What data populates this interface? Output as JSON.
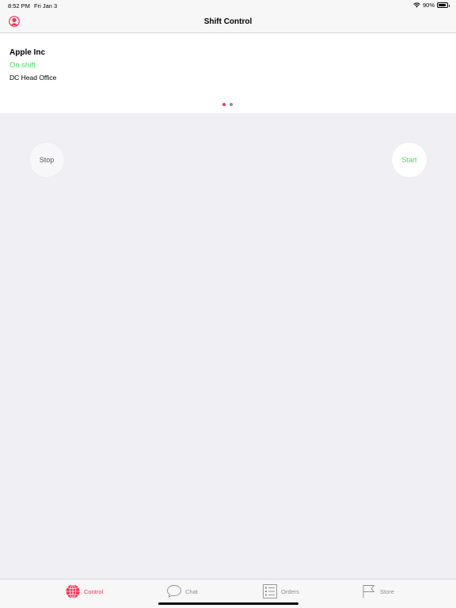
{
  "status_bar": {
    "time": "8:52 PM",
    "date": "Fri Jan 3",
    "battery": "90%",
    "battery_level": 0.9
  },
  "nav": {
    "title": "Shift Control",
    "profile_icon": "user-circle-icon"
  },
  "card": {
    "company": "Apple Inc",
    "status": "On shift",
    "office": "DC Head Office",
    "page_count": 2,
    "active_page": 1
  },
  "actions": {
    "stop_label": "Stop",
    "start_label": "Start"
  },
  "tabs": [
    {
      "label": "Control",
      "icon": "globe-icon",
      "active": true
    },
    {
      "label": "Chat",
      "icon": "chat-bubble-icon",
      "active": false
    },
    {
      "label": "Orders",
      "icon": "list-icon",
      "active": false
    },
    {
      "label": "Store",
      "icon": "flag-icon",
      "active": false
    }
  ],
  "colors": {
    "accent": "#ff2d55",
    "on_shift": "#4cd964",
    "background": "#efeff4"
  }
}
